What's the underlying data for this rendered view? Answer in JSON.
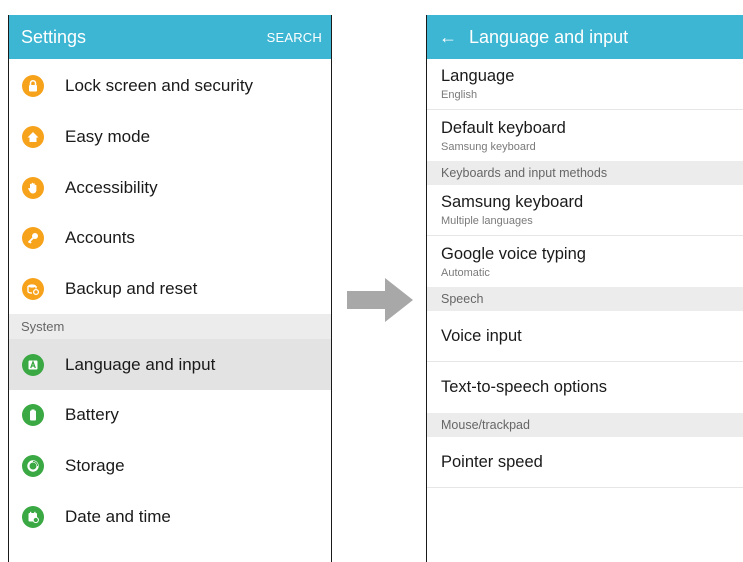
{
  "colors": {
    "header": "#3cb6d3",
    "orange": "#f7a21b",
    "green": "#3aa843",
    "selected_bg": "#e3e3e3"
  },
  "left": {
    "header": {
      "title": "Settings",
      "action": "SEARCH"
    },
    "items": [
      {
        "label": "Lock screen and security",
        "icon": "lock-icon",
        "color": "#f7a21b"
      },
      {
        "label": "Easy mode",
        "icon": "home-icon",
        "color": "#f7a21b"
      },
      {
        "label": "Accessibility",
        "icon": "hand-icon",
        "color": "#f7a21b"
      },
      {
        "label": "Accounts",
        "icon": "key-icon",
        "color": "#f7a21b"
      },
      {
        "label": "Backup and reset",
        "icon": "backup-icon",
        "color": "#f7a21b"
      }
    ],
    "section": "System",
    "system_items": [
      {
        "label": "Language and input",
        "icon": "language-icon",
        "color": "#3aa843",
        "selected": true
      },
      {
        "label": "Battery",
        "icon": "battery-icon",
        "color": "#3aa843"
      },
      {
        "label": "Storage",
        "icon": "storage-icon",
        "color": "#3aa843"
      },
      {
        "label": "Date and time",
        "icon": "calendar-icon",
        "color": "#3aa843"
      }
    ]
  },
  "right": {
    "header": {
      "title": "Language and input",
      "back_icon": "back-arrow-icon"
    },
    "language": {
      "title": "Language",
      "sub": "English"
    },
    "default_keyboard": {
      "title": "Default keyboard",
      "sub": "Samsung keyboard"
    },
    "sec_keyboards": "Keyboards and input methods",
    "samsung_keyboard": {
      "title": "Samsung keyboard",
      "sub": "Multiple languages"
    },
    "google_voice": {
      "title": "Google voice typing",
      "sub": "Automatic"
    },
    "sec_speech": "Speech",
    "voice_input": {
      "title": "Voice input"
    },
    "tts": {
      "title": "Text-to-speech options"
    },
    "sec_mouse": "Mouse/trackpad",
    "pointer_speed": {
      "title": "Pointer speed"
    }
  },
  "transition_icon": "right-arrow-icon"
}
